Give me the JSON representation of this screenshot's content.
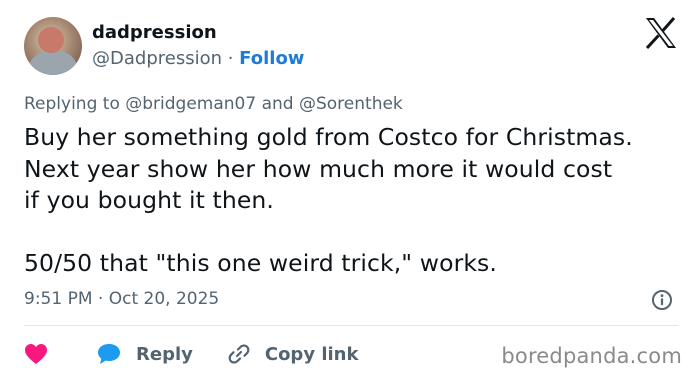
{
  "author": {
    "name": "dadpression",
    "handle": "@Dadpression",
    "separator": " · ",
    "follow_label": "Follow"
  },
  "reply_context": {
    "prefix": "Replying to ",
    "mention1": "@bridgeman07",
    "joiner": " and ",
    "mention2": "@Sorenthek"
  },
  "tweet": {
    "text": "Buy her something gold from Costco for Christmas.\nNext year show her how much more it would cost\nif you bought it then.\n\n50/50 that \"this one weird trick,\" works."
  },
  "meta": {
    "time": "9:51 PM",
    "separator": " · ",
    "date": "Oct 20, 2025"
  },
  "actions": {
    "reply_label": "Reply",
    "copy_link_label": "Copy link"
  },
  "watermark": "boredpanda.com",
  "colors": {
    "like": "#f91880",
    "reply": "#1d9bf0",
    "follow": "#1d7bd8",
    "muted": "#536471"
  },
  "icons": [
    "x-logo-icon",
    "info-icon",
    "heart-icon",
    "reply-bubble-icon",
    "link-icon"
  ]
}
